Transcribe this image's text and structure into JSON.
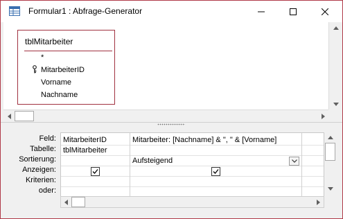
{
  "window": {
    "title": "Formular1 : Abfrage-Generator",
    "border_color": "#b03a48"
  },
  "table": {
    "name": "tblMitarbeiter",
    "fields": [
      "*",
      "MitarbeiterID",
      "Vorname",
      "Nachname"
    ],
    "primary_key_field": "MitarbeiterID"
  },
  "grid": {
    "row_labels": [
      "Feld:",
      "Tabelle:",
      "Sortierung:",
      "Anzeigen:",
      "Kriterien:",
      "oder:"
    ],
    "columns": [
      {
        "field": "MitarbeiterID",
        "table": "tblMitarbeiter",
        "sort": "",
        "show": true,
        "criteria": "",
        "or": ""
      },
      {
        "field": "Mitarbeiter: [Nachname] & \", \" & [Vorname]",
        "table": "",
        "sort": "Aufsteigend",
        "show": true,
        "criteria": "",
        "or": ""
      },
      {
        "field": "",
        "table": "",
        "sort": "",
        "show": false,
        "criteria": "",
        "or": ""
      }
    ]
  },
  "icons": {
    "app": "query-designer-icon",
    "minimize": "minimize-icon",
    "maximize": "maximize-icon",
    "close": "close-icon",
    "key": "key-icon",
    "dropdown": "chevron-down-icon"
  }
}
